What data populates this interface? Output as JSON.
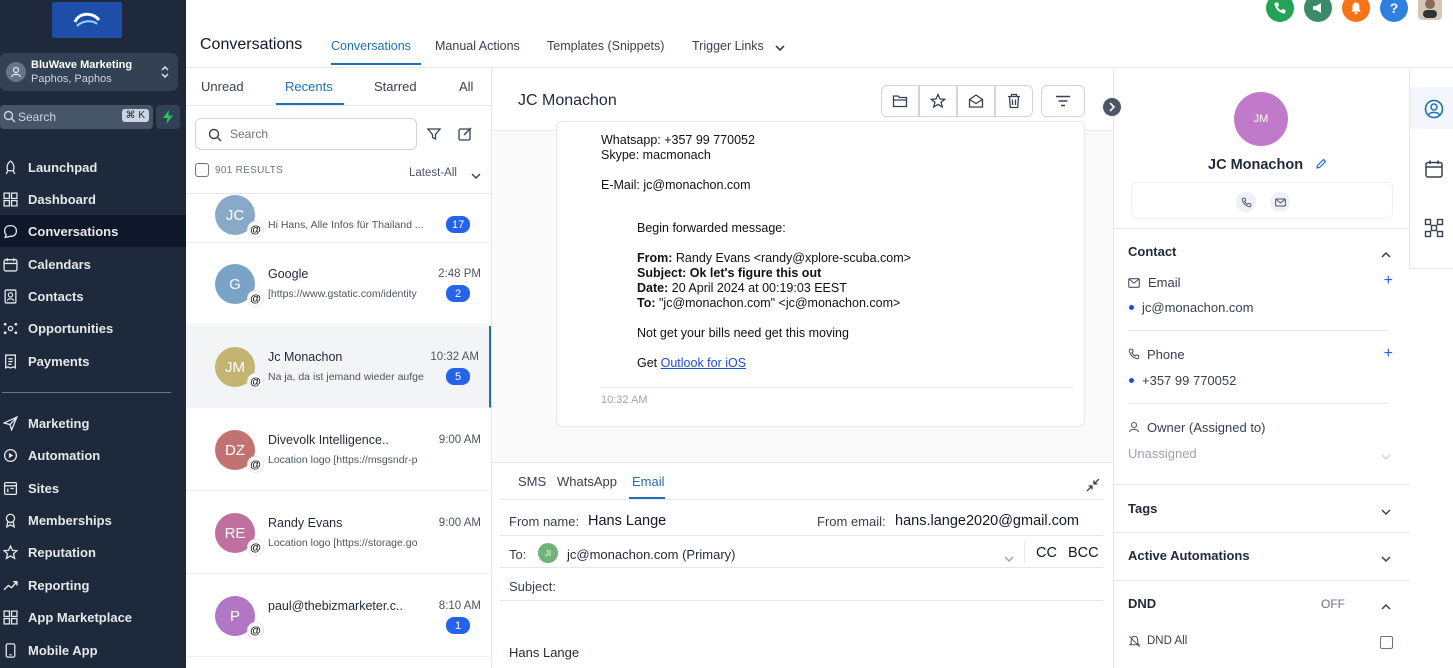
{
  "sidebar": {
    "location_name": "BluWave Marketing",
    "location_sub": "Paphos, Paphos",
    "search_placeholder": "Search",
    "search_shortcut": "⌘ K",
    "nav": [
      {
        "label": "Launchpad",
        "icon": "rocket-icon"
      },
      {
        "label": "Dashboard",
        "icon": "grid-icon"
      },
      {
        "label": "Conversations",
        "icon": "chat-icon",
        "active": true
      },
      {
        "label": "Calendars",
        "icon": "calendar-icon"
      },
      {
        "label": "Contacts",
        "icon": "contacts-icon"
      },
      {
        "label": "Opportunities",
        "icon": "network-icon"
      },
      {
        "label": "Payments",
        "icon": "receipt-icon"
      },
      {
        "label": "Marketing",
        "icon": "send-icon"
      },
      {
        "label": "Automation",
        "icon": "automation-icon"
      },
      {
        "label": "Sites",
        "icon": "sites-icon"
      },
      {
        "label": "Memberships",
        "icon": "award-icon"
      },
      {
        "label": "Reputation",
        "icon": "star-icon"
      },
      {
        "label": "Reporting",
        "icon": "trend-icon"
      },
      {
        "label": "App Marketplace",
        "icon": "apps-icon"
      },
      {
        "label": "Mobile App",
        "icon": "phone-icon"
      }
    ]
  },
  "header": {
    "title": "Conversations",
    "tabs": [
      "Conversations",
      "Manual Actions",
      "Templates (Snippets)",
      "Trigger Links"
    ],
    "icons": [
      {
        "name": "phone-call-icon",
        "color": "#22a355"
      },
      {
        "name": "megaphone-icon",
        "color": "#3b8a6a"
      },
      {
        "name": "bell-icon",
        "color": "#f97316"
      },
      {
        "name": "help-icon",
        "color": "#2d7fe0"
      }
    ]
  },
  "list": {
    "tabs": [
      "Unread",
      "Recents",
      "Starred",
      "All"
    ],
    "search_placeholder": "Search",
    "results": "901 RESULTS",
    "sort": "Latest-All",
    "conversations": [
      {
        "initials": "JC",
        "color": "#8aa9c9",
        "name": "",
        "time": "",
        "preview": "Hi Hans,    Alle Infos für Thailand ...",
        "count": "17"
      },
      {
        "initials": "G",
        "color": "#7ba3c8",
        "name": "Google",
        "time": "2:48 PM",
        "preview": "[https://www.gstatic.com/identity",
        "count": "2"
      },
      {
        "initials": "JM",
        "color": "#c4b472",
        "name": "Jc Monachon",
        "time": "10:32 AM",
        "preview": "Na ja, da ist jemand wieder aufge",
        "count": "5"
      },
      {
        "initials": "DZ",
        "color": "#c27270",
        "name": "Divevolk Intelligence..",
        "time": "9:00 AM",
        "preview": "Location logo [https://msgsndr-p",
        "count": ""
      },
      {
        "initials": "RE",
        "color": "#c0709e",
        "name": "Randy Evans",
        "time": "9:00 AM",
        "preview": "Location logo [https://storage.go",
        "count": ""
      },
      {
        "initials": "P",
        "color": "#b177c4",
        "name": "paul@thebizmarketer.c..",
        "time": "8:10 AM",
        "preview": "",
        "count": "1"
      }
    ]
  },
  "message": {
    "contact_name": "JC Monachon",
    "email": {
      "whatsapp": "Whatsapp: +357 99 770052",
      "skype": "Skype: macmonach",
      "email_line": "E-Mail: jc@monachon.com",
      "forward_header": "Begin forwarded message:",
      "from_label": "From:",
      "from_value": " Randy Evans <randy@xplore-scuba.com>",
      "subject_label": "Subject:",
      "subject_value": " Ok let's figure this out",
      "date_label": "Date:",
      "date_value": " 20 April 2024 at 00:19:03 EEST",
      "to_label": "To:",
      "to_value": " \"jc@monachon.com\" <jc@monachon.com>",
      "body": "Not get your bills need get this moving",
      "get_prefix": "Get ",
      "link": "Outlook for iOS",
      "time": "10:32 AM"
    }
  },
  "composer": {
    "tabs": [
      "SMS",
      "WhatsApp",
      "Email"
    ],
    "from_name_label": "From name:",
    "from_name": "Hans Lange",
    "from_email_label": "From email:",
    "from_email": "hans.lange2020@gmail.com",
    "to_label": "To:",
    "to_initials": "JI",
    "to_value": "jc@monachon.com (Primary)",
    "cc": "CC",
    "bcc": "BCC",
    "subject_label": "Subject:",
    "signature": "Hans Lange"
  },
  "contact": {
    "initials": "JM",
    "name": "JC Monachon",
    "section_contact": "Contact",
    "email_label": "Email",
    "email_value": "jc@monachon.com",
    "phone_label": "Phone",
    "phone_value": "+357 99 770052",
    "owner_label": "Owner (Assigned to)",
    "owner_value": "Unassigned",
    "tags": "Tags",
    "automations": "Active Automations",
    "dnd": "DND",
    "dnd_state": "OFF",
    "dnd_all": "DND All"
  }
}
